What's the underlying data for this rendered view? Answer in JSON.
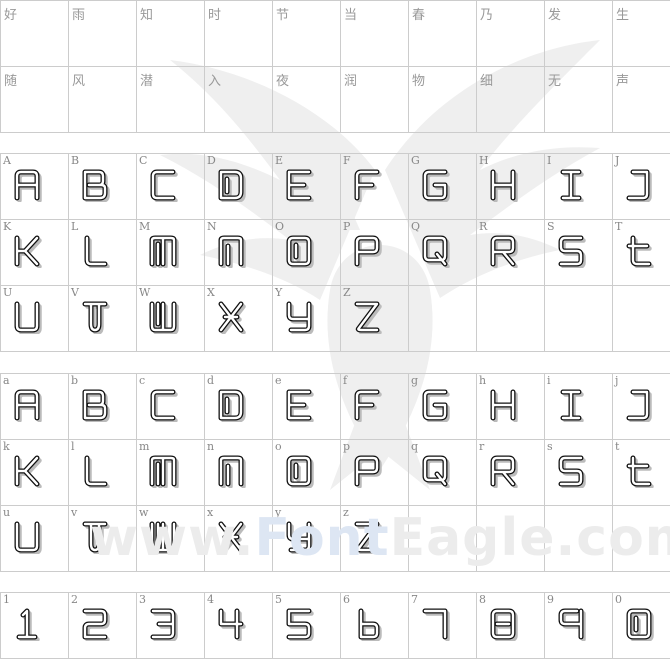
{
  "sample_rows": [
    [
      "好",
      "雨",
      "知",
      "时",
      "节",
      "当",
      "春",
      "乃",
      "发",
      "生"
    ],
    [
      "随",
      "风",
      "潜",
      "入",
      "夜",
      "润",
      "物",
      "细",
      "无",
      "声"
    ]
  ],
  "uppercase_rows": [
    [
      "A",
      "B",
      "C",
      "D",
      "E",
      "F",
      "G",
      "H",
      "I",
      "J"
    ],
    [
      "K",
      "L",
      "M",
      "N",
      "O",
      "P",
      "Q",
      "R",
      "S",
      "T"
    ],
    [
      "U",
      "V",
      "W",
      "X",
      "Y",
      "Z"
    ]
  ],
  "lowercase_rows": [
    [
      "a",
      "b",
      "c",
      "d",
      "e",
      "f",
      "g",
      "h",
      "i",
      "j"
    ],
    [
      "k",
      "l",
      "m",
      "n",
      "o",
      "p",
      "q",
      "r",
      "s",
      "t"
    ],
    [
      "u",
      "v",
      "w",
      "x",
      "y",
      "z"
    ]
  ],
  "digits_row": [
    "1",
    "2",
    "3",
    "4",
    "5",
    "6",
    "7",
    "8",
    "9",
    "0"
  ],
  "watermark": {
    "prefix": "www.",
    "brand": "Font",
    "suffix": "Eagle.com"
  },
  "colors": {
    "grid_border": "#cccccc",
    "label_text": "#888888",
    "glyph_stroke": "#111111",
    "glyph_shadow": "#bbbbbb"
  }
}
